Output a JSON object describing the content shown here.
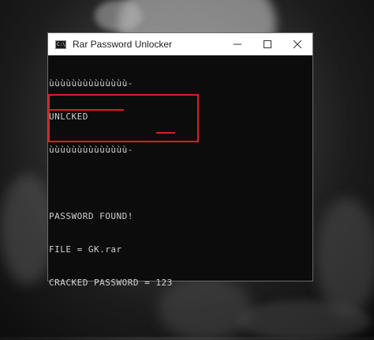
{
  "window": {
    "title": "Rar Password Unlocker",
    "icon": "console-app-icon",
    "icon_text": "C:\\"
  },
  "controls": {
    "minimize": "minimize-icon",
    "maximize": "maximize-icon",
    "close": "close-icon"
  },
  "console": {
    "lines": [
      "ùùùùùùùùùùùùùù-",
      "UNLCKED",
      "ùùùùùùùùùùùùùù-",
      "",
      "PASSWORD FOUND!",
      "FILE = GK.rar",
      "CRACKED PASSWORD = 123"
    ]
  },
  "annotation": {
    "color": "#e01b24"
  }
}
